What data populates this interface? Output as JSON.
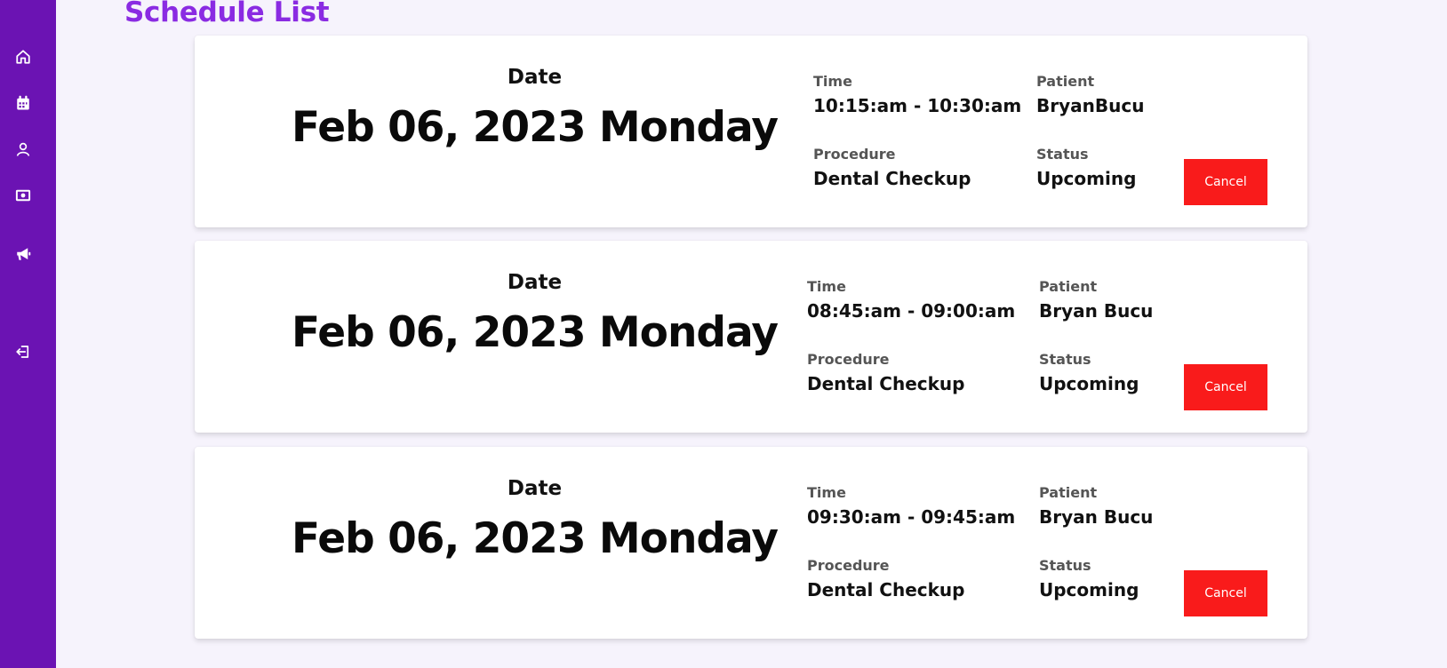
{
  "page": {
    "title": "Schedule List"
  },
  "sidebar": {
    "items": [
      {
        "icon": "home-icon"
      },
      {
        "icon": "calendar-icon"
      },
      {
        "icon": "user-icon"
      },
      {
        "icon": "money-icon"
      },
      {
        "icon": "megaphone-icon"
      },
      {
        "icon": "logout-icon"
      }
    ]
  },
  "schedules": [
    {
      "date_label": "Date",
      "date": "Feb 06, 2023 Monday",
      "time_label": "Time",
      "time": "10:15:am - 10:30:am",
      "patient_label": "Patient",
      "patient": "BryanBucu",
      "procedure_label": "Procedure",
      "procedure": "Dental Checkup",
      "status_label": "Status",
      "status": "Upcoming",
      "cancel_label": "Cancel"
    },
    {
      "date_label": "Date",
      "date": "Feb 06, 2023 Monday",
      "time_label": "Time",
      "time": "08:45:am - 09:00:am",
      "patient_label": "Patient",
      "patient": "Bryan Bucu",
      "procedure_label": "Procedure",
      "procedure": "Dental Checkup",
      "status_label": "Status",
      "status": "Upcoming",
      "cancel_label": "Cancel"
    },
    {
      "date_label": "Date",
      "date": "Feb 06, 2023 Monday",
      "time_label": "Time",
      "time": "09:30:am - 09:45:am",
      "patient_label": "Patient",
      "patient": "Bryan Bucu",
      "procedure_label": "Procedure",
      "procedure": "Dental Checkup",
      "status_label": "Status",
      "status": "Upcoming",
      "cancel_label": "Cancel"
    }
  ],
  "colors": {
    "sidebar": "#6b13b3",
    "title": "#8a2be2",
    "cancel": "#f91b1b",
    "background": "#f6f3fc"
  }
}
